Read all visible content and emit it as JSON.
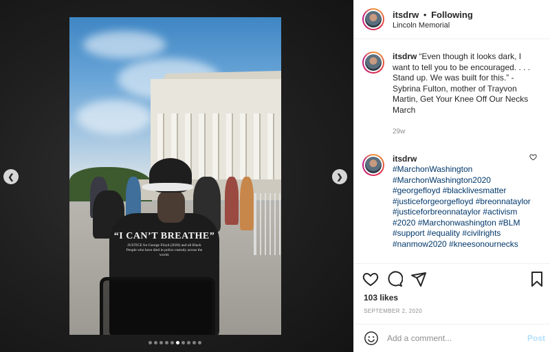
{
  "post": {
    "username": "itsdrw",
    "follow_separator": "•",
    "follow_label": "Following",
    "location": "Lincoln Memorial",
    "photo_text": {
      "shirt_headline": "“I CAN’T BREATHE”",
      "shirt_subtext": "JUSTICE for George Floyd (2020) and all Black People who have died in police custody across the world."
    },
    "carousel": {
      "prev_icon": "chevron-left-icon",
      "next_icon": "chevron-right-icon",
      "dot_count": 10,
      "active_index": 5
    }
  },
  "comments": [
    {
      "username": "itsdrw",
      "text": "“Even though it looks dark, I want to tell you to be encouraged. . . . Stand up. We was built for this.” - Sybrina Fulton, mother of Trayvon Martin, Get Your Knee Off Our Necks March",
      "time": "29w"
    },
    {
      "username": "itsdrw",
      "text": "#MarchonWashington #MarchonWashington2020 #georgefloyd #blacklivesmatter #justiceforgeorgefloyd #breonnataylor #justiceforbreonnataylor #activism #2020 #Marchonwashington #BLM #support #equality #civilrights #nanmow2020 #kneesonournecks"
    }
  ],
  "actions": {
    "like_icon": "heart-icon",
    "comment_icon": "comment-bubble-icon",
    "share_icon": "paper-plane-icon",
    "save_icon": "bookmark-icon"
  },
  "likes": "103 likes",
  "date": "SEPTEMBER 2, 2020",
  "composer": {
    "emoji_icon": "smiley-icon",
    "placeholder": "Add a comment...",
    "post_label": "Post"
  },
  "colors": {
    "link": "#00376b",
    "post_disabled": "#b2dffc",
    "text": "#262626",
    "muted": "#8e8e8e"
  }
}
